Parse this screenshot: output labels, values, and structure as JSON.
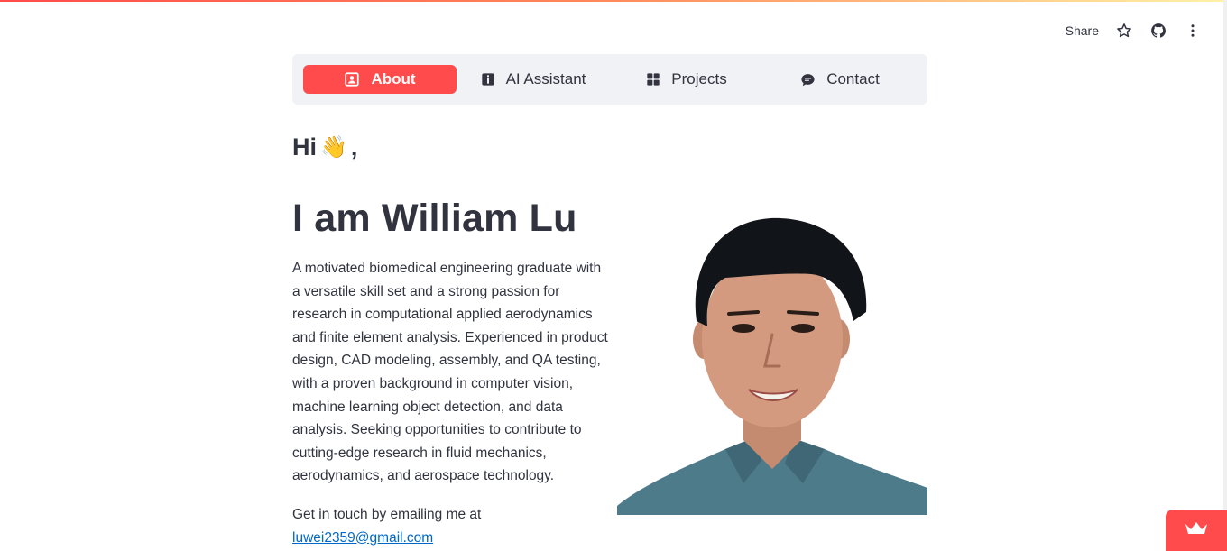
{
  "toolbar": {
    "share_label": "Share",
    "icons": [
      "star-icon",
      "github-icon",
      "more-vertical-icon"
    ]
  },
  "nav": {
    "active_color": "#ff4b4b",
    "items": [
      {
        "label": "About",
        "icon": "person-id-icon",
        "active": true
      },
      {
        "label": "AI Assistant",
        "icon": "info-square-icon",
        "active": false
      },
      {
        "label": "Projects",
        "icon": "grid-icon",
        "active": false
      },
      {
        "label": "Contact",
        "icon": "chat-bubble-icon",
        "active": false
      }
    ]
  },
  "hero": {
    "greeting": "Hi",
    "greeting_emoji": "👋",
    "greeting_suffix": ",",
    "title": "I am William Lu",
    "bio": "A motivated biomedical engineering graduate with a versatile skill set and a strong passion for research in computational applied aerodynamics and finite element analysis. Experienced in product design, CAD modeling, assembly, and QA testing, with a proven background in computer vision, machine learning object detection, and data analysis. Seeking opportunities to contribute to cutting-edge research in fluid mechanics, aerodynamics, and aerospace technology.",
    "contact_text": "Get in touch by emailing me at",
    "email": "luwei2359@gmail.com"
  },
  "badge": {
    "icon": "crown-icon",
    "color": "#ff4b4b"
  }
}
